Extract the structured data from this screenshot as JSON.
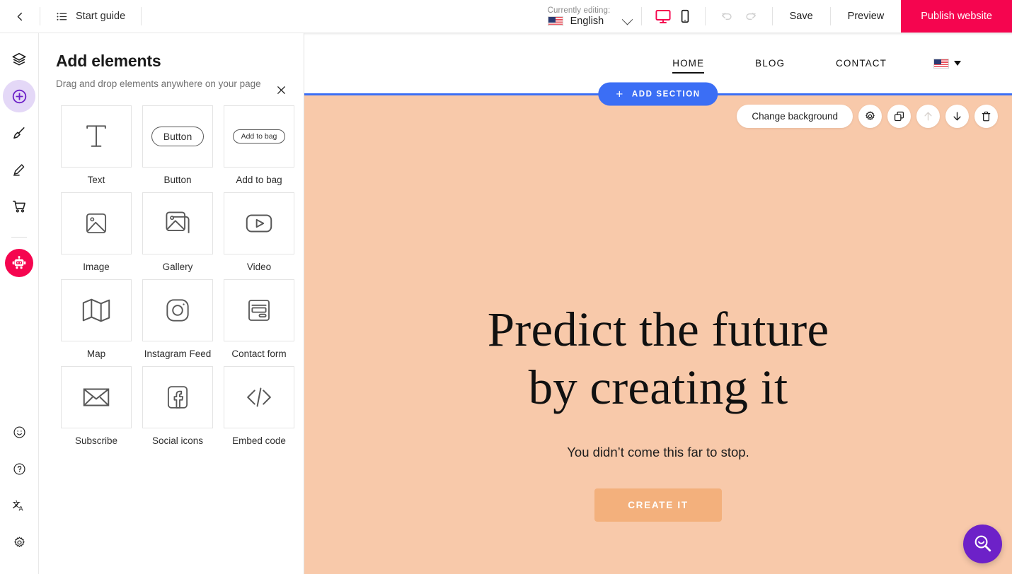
{
  "topbar": {
    "back_icon": "chevron-left-icon",
    "start_guide": {
      "label": "Start guide",
      "icon": "list-icon"
    },
    "language": {
      "caption": "Currently editing:",
      "value": "English",
      "flag": "us-flag-icon",
      "chevron": "chevron-down-icon"
    },
    "devices": {
      "desktop": {
        "icon": "desktop-icon",
        "active": true,
        "color": "#f5054f"
      },
      "mobile": {
        "icon": "mobile-icon",
        "active": false,
        "color": "#1e1e1e"
      }
    },
    "history": {
      "undo": {
        "icon": "undo-icon",
        "enabled": false
      },
      "redo": {
        "icon": "redo-icon",
        "enabled": false
      }
    },
    "save_label": "Save",
    "preview_label": "Preview",
    "publish_label": "Publish website",
    "publish_color": "#f5054f"
  },
  "rail": {
    "items": [
      {
        "name": "layers",
        "icon": "layers-icon",
        "active": false
      },
      {
        "name": "add-elements",
        "icon": "plus-circle-icon",
        "active": true
      },
      {
        "name": "design",
        "icon": "paintbrush-icon",
        "active": false
      },
      {
        "name": "edit",
        "icon": "pencil-icon",
        "active": false
      },
      {
        "name": "store",
        "icon": "cart-icon",
        "active": false
      }
    ],
    "ai": {
      "name": "ai-assistant",
      "icon": "robot-icon",
      "color": "#f5054f"
    },
    "bottom_items": [
      {
        "name": "feedback",
        "icon": "smiley-icon"
      },
      {
        "name": "help",
        "icon": "question-circle-icon"
      },
      {
        "name": "translate",
        "icon": "translate-icon"
      },
      {
        "name": "settings",
        "icon": "gear-icon"
      }
    ]
  },
  "panel": {
    "title": "Add elements",
    "subtitle": "Drag and drop elements anywhere on your page",
    "close_icon": "close-icon",
    "elements": [
      {
        "label": "Text",
        "icon": "text-t-icon"
      },
      {
        "label": "Button",
        "icon": "button-pill-icon",
        "pill_text": "Button"
      },
      {
        "label": "Add to bag",
        "icon": "add-to-bag-pill-icon",
        "pill_text": "Add to bag"
      },
      {
        "label": "Image",
        "icon": "image-icon"
      },
      {
        "label": "Gallery",
        "icon": "gallery-icon"
      },
      {
        "label": "Video",
        "icon": "video-play-icon"
      },
      {
        "label": "Map",
        "icon": "map-icon"
      },
      {
        "label": "Instagram Feed",
        "icon": "instagram-icon"
      },
      {
        "label": "Contact form",
        "icon": "contact-form-icon"
      },
      {
        "label": "Subscribe",
        "icon": "envelope-icon"
      },
      {
        "label": "Social icons",
        "icon": "facebook-icon"
      },
      {
        "label": "Embed code",
        "icon": "code-brackets-icon"
      }
    ]
  },
  "canvas": {
    "site_nav": {
      "items": [
        {
          "label": "HOME",
          "active": true
        },
        {
          "label": "BLOG",
          "active": false
        },
        {
          "label": "CONTACT",
          "active": false
        }
      ],
      "lang_flag": "us-flag-icon",
      "lang_caret": "caret-down-icon"
    },
    "add_section": {
      "label": "ADD SECTION",
      "icon": "plus-icon",
      "color": "#3b6ef5"
    },
    "section_toolbar": {
      "change_background_label": "Change background",
      "buttons": [
        {
          "name": "settings",
          "icon": "gear-icon",
          "enabled": true
        },
        {
          "name": "duplicate",
          "icon": "copy-icon",
          "enabled": true
        },
        {
          "name": "move-up",
          "icon": "arrow-up-icon",
          "enabled": false
        },
        {
          "name": "move-down",
          "icon": "arrow-down-icon",
          "enabled": true
        },
        {
          "name": "delete",
          "icon": "trash-icon",
          "enabled": true
        }
      ]
    },
    "hero": {
      "background_color": "#f8c9aa",
      "title_line1": "Predict the future",
      "title_line2": "by creating it",
      "subtitle": "You didn’t come this far to stop.",
      "cta_label": "CREATE IT",
      "cta_color": "#f3b07c"
    },
    "chat": {
      "icon": "search-smile-icon",
      "color": "#6d21c8"
    }
  }
}
